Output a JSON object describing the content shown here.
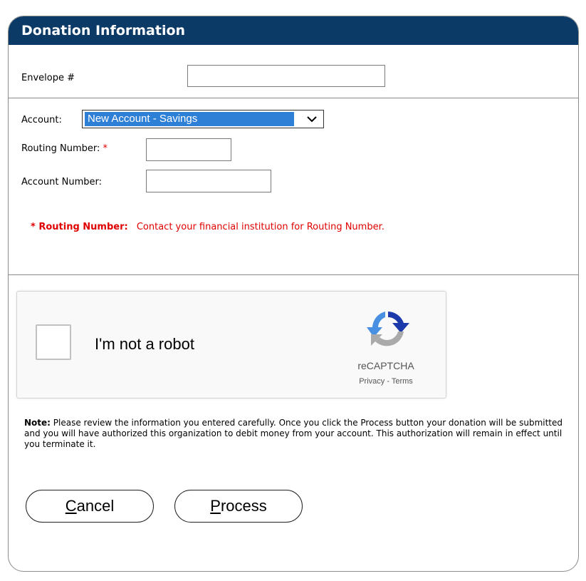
{
  "header": {
    "title": "Donation Information"
  },
  "envelope": {
    "label": "Envelope #",
    "value": ""
  },
  "account": {
    "label": "Account:",
    "selected": "New Account - Savings"
  },
  "routing": {
    "label": "Routing Number:",
    "required_mark": "*",
    "value": ""
  },
  "account_number": {
    "label": "Account Number:",
    "value": ""
  },
  "routing_note": {
    "marker": "* Routing Number:",
    "text": "Contact your financial institution for Routing Number."
  },
  "captcha": {
    "label": "I'm not a robot",
    "brand": "reCAPTCHA",
    "privacy": "Privacy",
    "separator": " - ",
    "terms": "Terms"
  },
  "note": {
    "prefix": "Note:",
    "text": " Please review the information you entered carefully. Once you click the Process button your donation will be submitted and you will have authorized this organization to debit money from your account. This authorization will remain in effect until you terminate it."
  },
  "buttons": {
    "cancel": {
      "accel": "C",
      "rest": "ancel"
    },
    "process": {
      "accel": "P",
      "rest": "rocess"
    }
  },
  "colors": {
    "header_bg": "#0b3a67",
    "required": "#e00000",
    "select_highlight": "#2e7fd6"
  },
  "icons": {
    "captcha_logo": "recaptcha-logo-icon",
    "dropdown": "chevron-down-icon"
  }
}
